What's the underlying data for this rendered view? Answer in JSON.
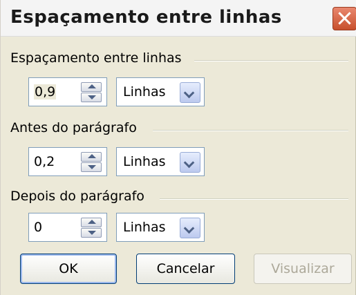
{
  "window": {
    "title": "Espaçamento entre linhas"
  },
  "groups": [
    {
      "label": "Espaçamento entre linhas",
      "value": "0,9",
      "unit": "Linhas"
    },
    {
      "label": "Antes do parágrafo",
      "value": "0,2",
      "unit": "Linhas"
    },
    {
      "label": "Depois do parágrafo",
      "value": "0",
      "unit": "Linhas"
    }
  ],
  "buttons": {
    "ok": "OK",
    "cancel": "Cancelar",
    "preview": "Visualizar"
  },
  "icons": {
    "close": "close-icon",
    "spin_up": "arrow-up-icon",
    "spin_down": "arrow-down-icon",
    "dropdown": "chevron-down-icon"
  },
  "colors": {
    "close_button": "#d0573a",
    "border_blue": "#7f9db9",
    "dialog_bg": "#ece9d8"
  }
}
